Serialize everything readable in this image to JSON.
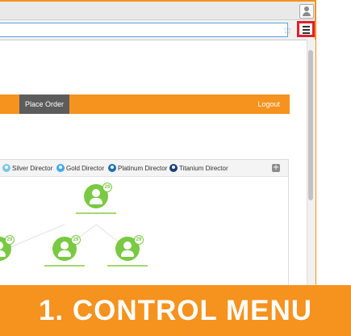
{
  "navbar": {
    "place_order": "Place Order",
    "logout": "Logout"
  },
  "legend": [
    {
      "label": "Silver Director",
      "color": "#7ac7e6"
    },
    {
      "label": "Gold Director",
      "color": "#3fa9f5"
    },
    {
      "label": "Platinum Director",
      "color": "#1f6fb5"
    },
    {
      "label": "Titanium Director",
      "color": "#1a3f7a"
    }
  ],
  "tree": {
    "node_badge": "29"
  },
  "caption": {
    "text": "1. CONTROL MENU"
  },
  "colors": {
    "accent": "#f6921e",
    "highlight": "#e0202d",
    "node": "#7ac943"
  },
  "icons": [
    "profile-icon",
    "star-icon",
    "hamburger-menu-icon",
    "expand-icon",
    "user-node-icon"
  ]
}
